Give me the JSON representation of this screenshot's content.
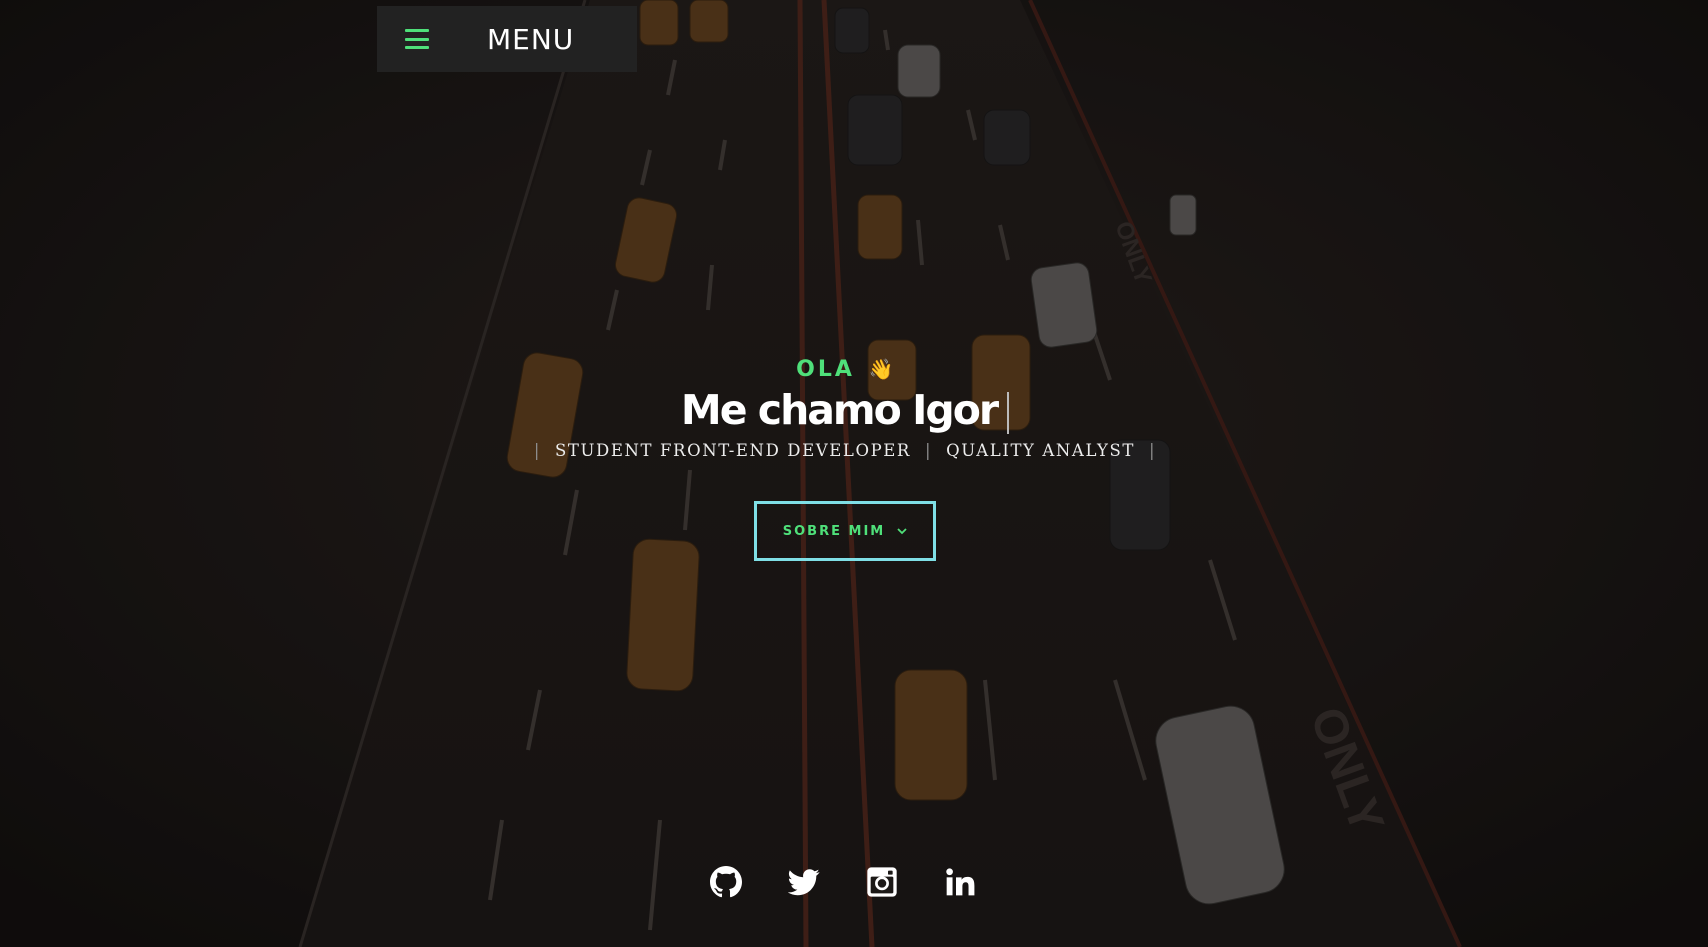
{
  "header": {
    "menu_label": "MENU",
    "menu_icon": "hamburger-icon"
  },
  "hero": {
    "greeting": "OLA",
    "greeting_emoji": "👋",
    "title": "Me chamo Igor",
    "roles": [
      "STUDENT FRONT-END DEVELOPER",
      "QUALITY ANALYST"
    ],
    "cta_label": "SOBRE MIM",
    "cta_icon": "chevron-down-icon"
  },
  "socials": [
    {
      "name": "github-icon"
    },
    {
      "name": "twitter-icon"
    },
    {
      "name": "instagram-icon"
    },
    {
      "name": "linkedin-icon"
    }
  ],
  "colors": {
    "accent": "#4fe07a",
    "button_border": "#7fdfe6",
    "menu_bg": "#222222",
    "background": "#161413"
  }
}
